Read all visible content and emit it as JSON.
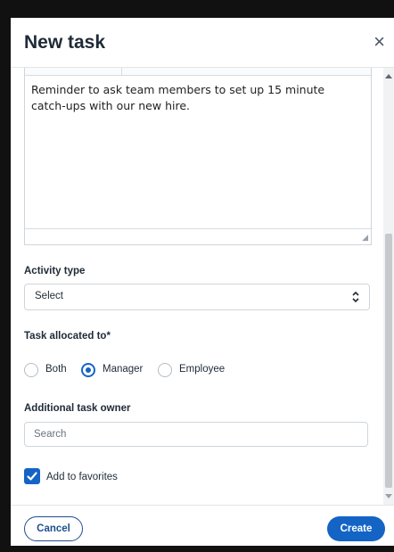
{
  "dialog": {
    "title": "New task",
    "close_icon": "×"
  },
  "editor": {
    "text": "Reminder to ask team members to set up 15 minute catch-ups with our new hire."
  },
  "activity_type": {
    "label": "Activity type",
    "selected": "Select"
  },
  "task_allocated": {
    "label": "Task allocated to*",
    "options": [
      {
        "label": "Both",
        "selected": false
      },
      {
        "label": "Manager",
        "selected": true
      },
      {
        "label": "Employee",
        "selected": false
      }
    ]
  },
  "additional_owner": {
    "label": "Additional task owner",
    "placeholder": "Search",
    "value": ""
  },
  "favorites": {
    "label": "Add to favorites",
    "checked": true
  },
  "footer": {
    "cancel_label": "Cancel",
    "create_label": "Create"
  },
  "colors": {
    "accent": "#1464c6",
    "annotation_arrow": "#e0201b"
  }
}
